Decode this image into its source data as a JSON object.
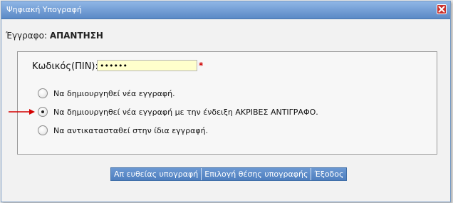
{
  "window": {
    "title": "Ψηφιακή Υπογραφή"
  },
  "document": {
    "label": "Έγγραφο:",
    "value": "ΑΠΑΝΤΗΣΗ"
  },
  "pin": {
    "label": "Κωδικός(ΠΙΝ):",
    "value": "••••••",
    "required_mark": "*"
  },
  "options": [
    {
      "label": "Να δημιουργηθεί νέα εγγραφή.",
      "selected": false
    },
    {
      "label": "Να δημιουργηθεί νέα εγγραφή με την ένδειξη ΑΚΡΙΒΕΣ ΑΝΤΙΓΡΑΦΟ.",
      "selected": true
    },
    {
      "label": "Να αντικατασταθεί στην ίδια εγγραφή.",
      "selected": false
    }
  ],
  "buttons": {
    "direct_sign": "Απ ευθείας υπογραφή",
    "choose_position": "Επιλογή θέσης υπογραφής",
    "exit": "Έξοδος"
  },
  "colors": {
    "arrow": "#d40000",
    "button": "#5a89c7",
    "pin_background": "#ffffcc"
  },
  "icons": {
    "close": "close-x-icon",
    "pointer": "red-arrow-icon"
  }
}
